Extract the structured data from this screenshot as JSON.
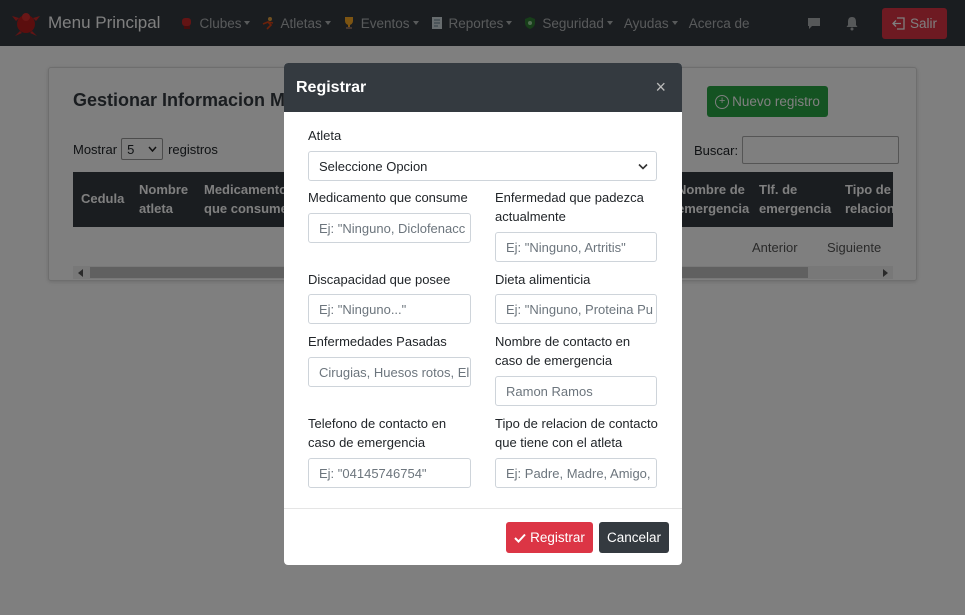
{
  "navbar": {
    "brand": "Menu Principal",
    "items": [
      {
        "label": "Clubes",
        "icon": "boxing-glove-icon"
      },
      {
        "label": "Atletas",
        "icon": "athlete-icon"
      },
      {
        "label": "Eventos",
        "icon": "trophy-icon"
      },
      {
        "label": "Reportes",
        "icon": "document-icon"
      },
      {
        "label": "Seguridad",
        "icon": "shield-icon"
      },
      {
        "label": "Ayudas",
        "icon": ""
      },
      {
        "label": "Acerca de",
        "icon": ""
      }
    ],
    "logout_label": "Salir"
  },
  "page": {
    "title": "Gestionar Informacion M",
    "new_button": "Nuevo registro",
    "show_label": "Mostrar",
    "show_value": "5",
    "records_label": "registros",
    "search_label": "Buscar:",
    "columns": [
      "Cedula",
      "Nombre atleta",
      "Medicamento que consume",
      "Nombre de emergencia",
      "Tlf. de emergencia",
      "Tipo de relacion"
    ],
    "prev_label": "Anterior",
    "next_label": "Siguiente"
  },
  "modal": {
    "title": "Registrar",
    "atleta_label": "Atleta",
    "atleta_value": "Seleccione Opcion",
    "medicamento_label": "Medicamento que consume",
    "medicamento_placeholder": "Ej: \"Ninguno, Diclofenacc",
    "enfermedad_label": "Enfermedad que padezca actualmente",
    "enfermedad_placeholder": "Ej: \"Ninguno, Artritis\"",
    "discapacidad_label": "Discapacidad que posee",
    "discapacidad_placeholder": "Ej:  \"Ninguno...\"",
    "dieta_label": "Dieta alimenticia",
    "dieta_placeholder": "Ej:  \"Ninguno, Proteina Pu",
    "pasadas_label": "Enfermedades Pasadas",
    "pasadas_placeholder": "Cirugias, Huesos rotos, El",
    "contacto_nombre_label": "Nombre de contacto en caso de emergencia",
    "contacto_nombre_placeholder": "Ramon Ramos",
    "telefono_label": "Telefono de contacto en caso de emergencia",
    "telefono_placeholder": "Ej: \"04145746754\"",
    "relacion_label": "Tipo de relacion de contacto que tiene con el atleta",
    "relacion_placeholder": "Ej: Padre, Madre, Amigo,",
    "submit_label": "Registrar",
    "cancel_label": "Cancelar"
  },
  "colors": {
    "navbar": "#343a40",
    "danger": "#dc3545",
    "success": "#28a745"
  }
}
